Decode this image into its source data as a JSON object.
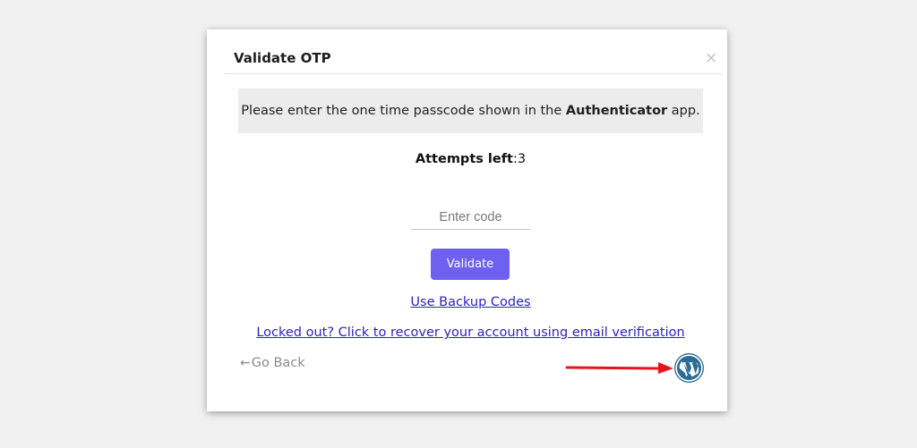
{
  "dialog": {
    "title": "Validate OTP",
    "close_icon": "×",
    "info_text_before": "Please enter the one time passcode shown in the ",
    "info_text_bold": "Authenticator",
    "info_text_after": " app.",
    "attempts_label": "Attempts left",
    "attempts_separator": ":",
    "attempts_value": "3",
    "code_input": {
      "placeholder": "Enter code",
      "value": ""
    },
    "validate_label": "Validate",
    "backup_link": "Use Backup Codes",
    "locked_out_link": "Locked out? Click to recover your account using email verification",
    "go_back_arrow": "←",
    "go_back_label": "Go Back",
    "wordpress_icon": "wordpress-logo-icon"
  },
  "annotation": {
    "arrow_color": "#e8141c"
  },
  "colors": {
    "accent": "#6f61f0",
    "link": "#2b22c4",
    "wordpress_blue": "#2c6b96"
  }
}
